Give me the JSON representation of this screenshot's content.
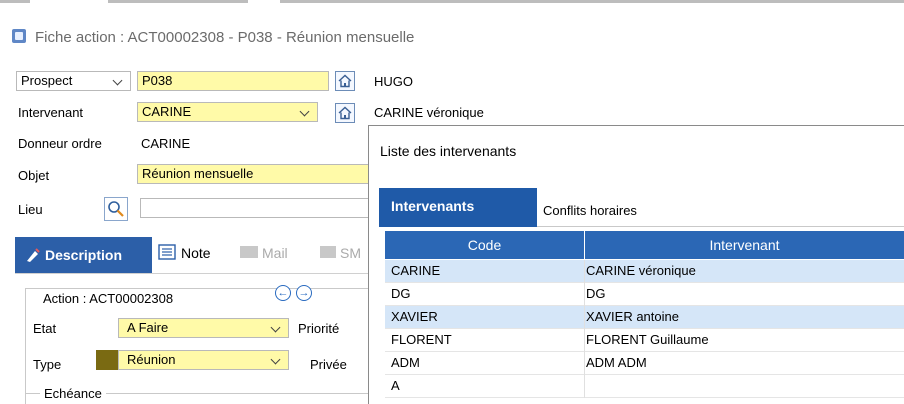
{
  "window": {
    "title": "Fiche action : ACT00002308 - P038 - Réunion mensuelle"
  },
  "form": {
    "prospect_select": "Prospect",
    "prospect_code": "P038",
    "prospect_name": "HUGO",
    "intervenant_label": "Intervenant",
    "intervenant_value": "CARINE",
    "intervenant_name": "CARINE véronique",
    "donneur_label": "Donneur ordre",
    "donneur_value": "CARINE",
    "objet_label": "Objet",
    "objet_value": "Réunion mensuelle",
    "lieu_label": "Lieu",
    "lieu_value": ""
  },
  "tabs": {
    "description": "Description",
    "note": "Note",
    "mail": "Mail",
    "sms": "SM"
  },
  "action_group": {
    "title": "Action : ACT00002308",
    "etat_label": "Etat",
    "etat_value": "A Faire",
    "priorite_label": "Priorité",
    "type_label": "Type",
    "type_value": "Réunion",
    "type_color": "#7a6a12",
    "privee_label": "Privée",
    "echeance_label": "Echéance"
  },
  "dialog": {
    "title": "Liste des intervenants",
    "tab_active": "Intervenants",
    "tab_other": "Conflits horaires",
    "columns": [
      "Code",
      "Intervenant"
    ],
    "rows": [
      {
        "code": "CARINE",
        "name": "CARINE véronique",
        "selected": true
      },
      {
        "code": "DG",
        "name": "DG",
        "selected": false
      },
      {
        "code": "XAVIER",
        "name": "XAVIER antoine",
        "selected": true
      },
      {
        "code": "FLORENT",
        "name": "FLORENT Guillaume",
        "selected": false
      },
      {
        "code": "ADM",
        "name": "ADM ADM",
        "selected": false
      },
      {
        "code": "A",
        "name": "",
        "selected": false
      }
    ]
  },
  "colors": {
    "accent": "#2c5fa8",
    "grid_header": "#2b67b5",
    "selected_row": "#d5e6f8",
    "required_field": "#fffaa8"
  }
}
